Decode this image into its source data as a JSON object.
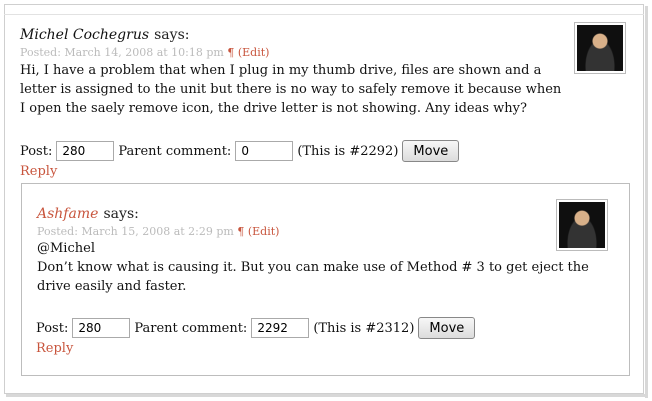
{
  "comments": [
    {
      "author": "Michel Cochegrus",
      "says": "says:",
      "posted": "Posted: March 14, 2008 at 10:18 pm",
      "pilcrow": "¶",
      "edit": "(Edit)",
      "body": "Hi, I have a problem that when I plug in my thumb drive, files are shown and a letter is assigned to the unit but there is no way to safely remove it because when I open the saely remove icon, the drive letter is not showing. Any ideas why?",
      "post_label": "Post:",
      "post_value": "280",
      "parent_label": "Parent comment:",
      "parent_value": "0",
      "this_is": "(This is #2292)",
      "move_label": "Move",
      "reply_label": "Reply"
    },
    {
      "author": "Ashfame",
      "says": "says:",
      "posted": "Posted: March 15, 2008 at 2:29 pm",
      "pilcrow": "¶",
      "edit": "(Edit)",
      "body_line1": "@Michel",
      "body_line2": "Don’t know what is causing it. But you can make use of Method # 3 to get eject the drive easily and faster.",
      "post_label": "Post:",
      "post_value": "280",
      "parent_label": "Parent comment:",
      "parent_value": "2292",
      "this_is": "(This is #2312)",
      "move_label": "Move",
      "reply_label": "Reply"
    }
  ]
}
